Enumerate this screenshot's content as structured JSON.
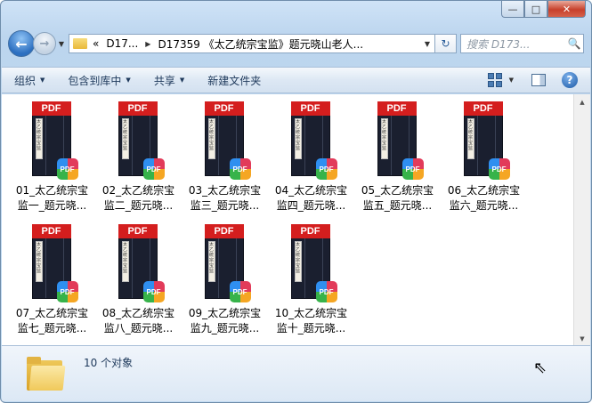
{
  "window": {
    "minimize_glyph": "—",
    "maximize_glyph": "□",
    "close_glyph": "✕"
  },
  "nav": {
    "back_glyph": "←",
    "forward_glyph": "→",
    "history_glyph": "▼"
  },
  "address": {
    "overflow": "«",
    "crumbs": [
      "D17...",
      "D17359 《太乙统宗宝监》题元晓山老人..."
    ],
    "separator": "▶",
    "dropdown": "▼",
    "refresh_glyph": "↻"
  },
  "search": {
    "placeholder": "搜索 D173...",
    "icon": "🔍"
  },
  "toolbar": {
    "organize": "组织",
    "include_in_library": "包含到库中",
    "share": "共享",
    "new_folder": "新建文件夹",
    "dropdown_glyph": "▼",
    "help_glyph": "?"
  },
  "file_badge": {
    "banner": "PDF",
    "icon": "PDF",
    "cover_title": "太乙统宗宝监"
  },
  "files": [
    {
      "line1": "01_太乙统宗宝",
      "line2": "监一_题元晓..."
    },
    {
      "line1": "02_太乙统宗宝",
      "line2": "监二_题元晓..."
    },
    {
      "line1": "03_太乙统宗宝",
      "line2": "监三_题元晓..."
    },
    {
      "line1": "04_太乙统宗宝",
      "line2": "监四_题元晓..."
    },
    {
      "line1": "05_太乙统宗宝",
      "line2": "监五_题元晓..."
    },
    {
      "line1": "06_太乙统宗宝",
      "line2": "监六_题元晓..."
    },
    {
      "line1": "07_太乙统宗宝",
      "line2": "监七_题元晓..."
    },
    {
      "line1": "08_太乙统宗宝",
      "line2": "监八_题元晓..."
    },
    {
      "line1": "09_太乙统宗宝",
      "line2": "监九_题元晓..."
    },
    {
      "line1": "10_太乙统宗宝",
      "line2": "监十_题元晓..."
    }
  ],
  "scrollbar": {
    "up": "▲",
    "down": "▼"
  },
  "details": {
    "count": "10 个对象"
  },
  "cursor_glyph": "⇖"
}
